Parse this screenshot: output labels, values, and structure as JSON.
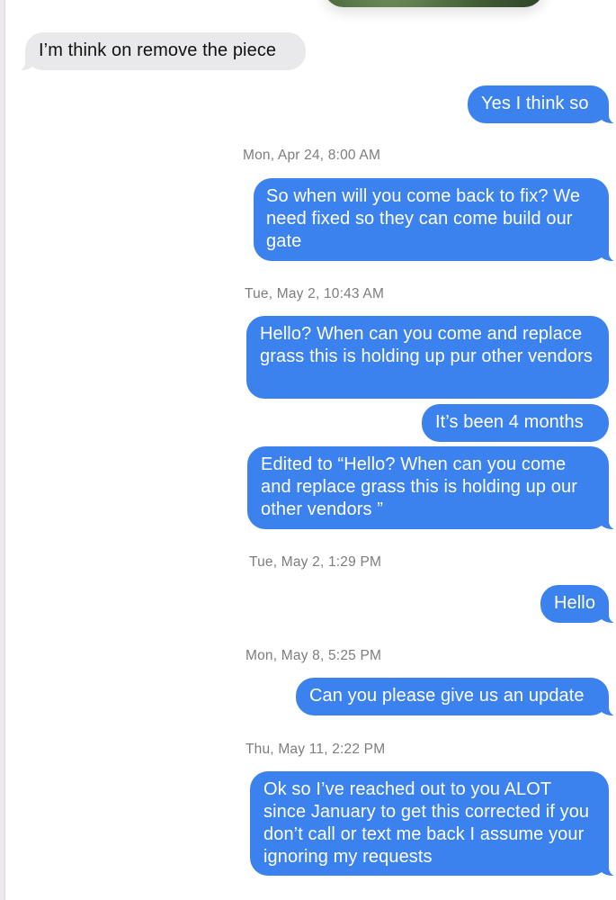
{
  "theme": {
    "outgoing_color": "#3b82ee",
    "incoming_color": "#e9e9eb",
    "timestamp_color": "#7d7d80"
  },
  "messages": {
    "m1": "I’m think on remove the piece",
    "m2": "Yes I think so",
    "ts1": "Mon, Apr 24, 8:00 AM",
    "m3": "So when will you come back to fix? We need fixed so they can come build our gate",
    "ts2": "Tue, May 2, 10:43 AM",
    "m4": "Hello? When can you come and replace grass this is holding up pur other vendors",
    "m5": "It’s been 4 months",
    "m6": "Edited to “Hello? When can you come and replace grass this is holding up our other vendors ”",
    "ts3": "Tue, May 2, 1:29 PM",
    "m7": "Hello",
    "ts4": "Mon, May 8, 5:25 PM",
    "m8": "Can you please give us an update",
    "ts5": "Thu, May 11, 2:22 PM",
    "m9": "Ok so I’ve reached out to you ALOT since January to get this corrected if you don’t call or text me back I assume your ignoring my requests"
  }
}
